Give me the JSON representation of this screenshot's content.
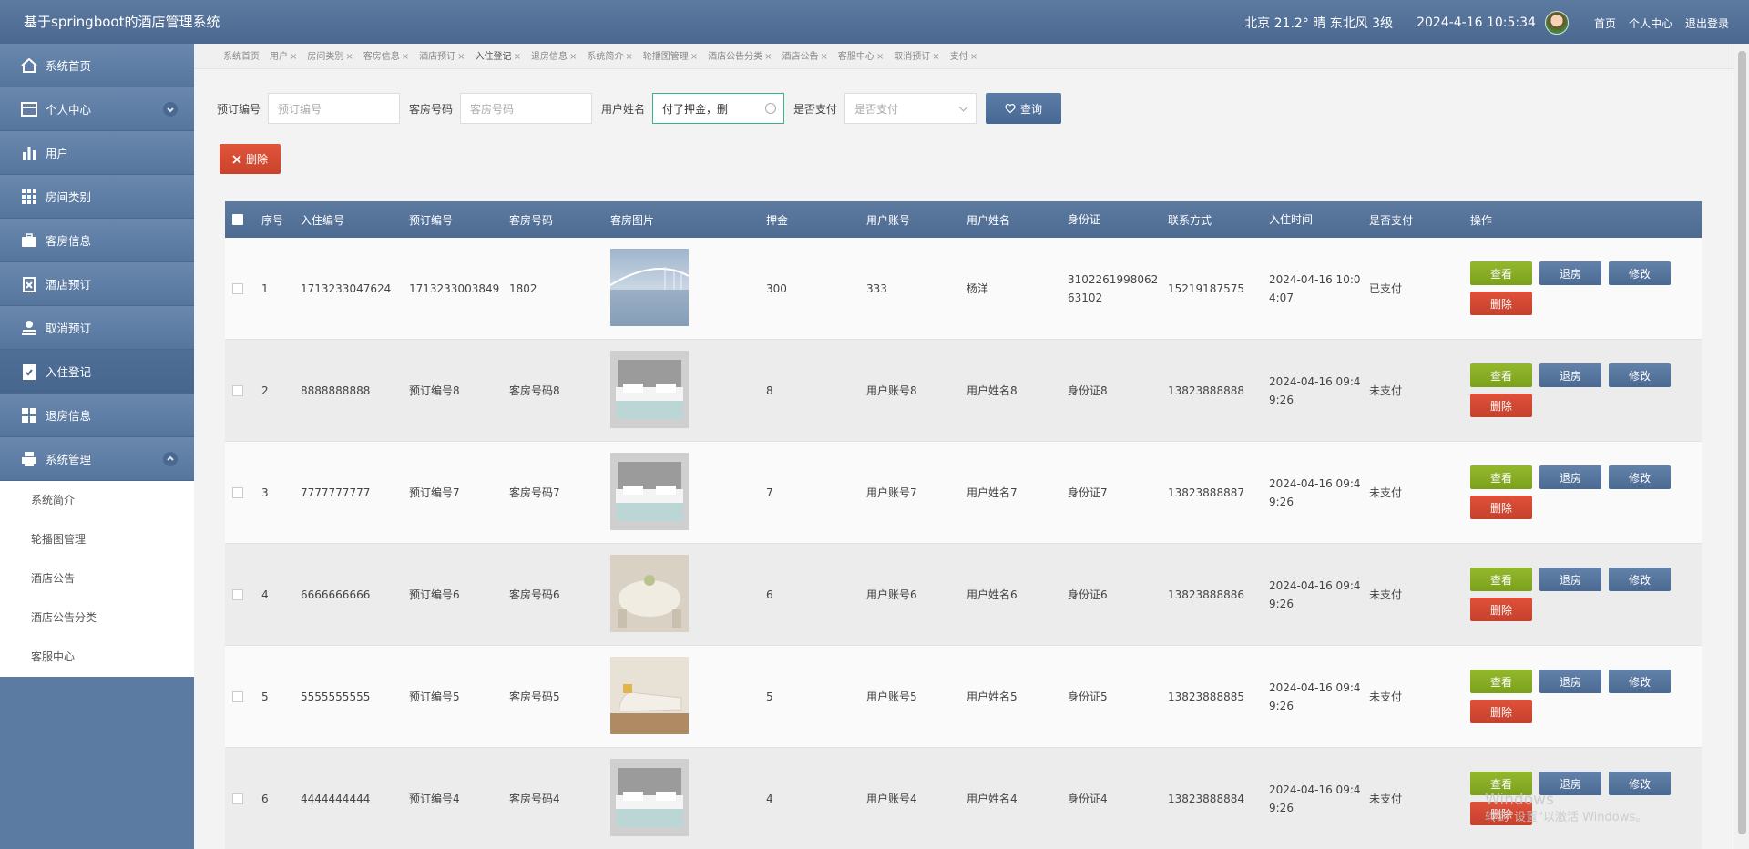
{
  "header": {
    "title": "基于springboot的酒店管理系统",
    "weather": "北京  21.2°  晴  东北风  3级",
    "datetime": "2024-4-16 10:5:34",
    "links": [
      "首页",
      "个人中心",
      "退出登录"
    ]
  },
  "sidebar": {
    "items": [
      {
        "label": "系统首页",
        "icon": "home-icon"
      },
      {
        "label": "个人中心",
        "icon": "card-icon",
        "expandable": true
      },
      {
        "label": "用户",
        "icon": "bar-chart-icon"
      },
      {
        "label": "房间类别",
        "icon": "grid-icon"
      },
      {
        "label": "客房信息",
        "icon": "briefcase-icon"
      },
      {
        "label": "酒店预订",
        "icon": "clipboard-x-icon"
      },
      {
        "label": "取消预订",
        "icon": "stamp-icon"
      },
      {
        "label": "入住登记",
        "icon": "clipboard-check-icon",
        "active": true
      },
      {
        "label": "退房信息",
        "icon": "tiles-icon"
      },
      {
        "label": "系统管理",
        "icon": "printer-icon",
        "expanded": true
      }
    ],
    "subitems": [
      "系统简介",
      "轮播图管理",
      "酒店公告",
      "酒店公告分类",
      "客服中心"
    ]
  },
  "tabs": [
    {
      "label": "系统首页",
      "closable": false
    },
    {
      "label": "用户",
      "closable": true
    },
    {
      "label": "房间类别",
      "closable": true
    },
    {
      "label": "客房信息",
      "closable": true
    },
    {
      "label": "酒店预订",
      "closable": true
    },
    {
      "label": "入住登记",
      "closable": true,
      "active": true
    },
    {
      "label": "退房信息",
      "closable": true
    },
    {
      "label": "系统简介",
      "closable": true
    },
    {
      "label": "轮播图管理",
      "closable": true
    },
    {
      "label": "酒店公告分类",
      "closable": true
    },
    {
      "label": "酒店公告",
      "closable": true
    },
    {
      "label": "客服中心",
      "closable": true
    },
    {
      "label": "取消预订",
      "closable": true
    },
    {
      "label": "支付",
      "closable": true
    }
  ],
  "search": {
    "booking_no_label": "预订编号",
    "booking_no_placeholder": "预订编号",
    "room_no_label": "客房号码",
    "room_no_placeholder": "客房号码",
    "username_label": "用户姓名",
    "username_value": "付了押金，删",
    "paid_label": "是否支付",
    "paid_placeholder": "是否支付",
    "query_label": "查询"
  },
  "delete_label": "删除",
  "table": {
    "headers": [
      "序号",
      "入住编号",
      "预订编号",
      "客房号码",
      "客房图片",
      "押金",
      "用户账号",
      "用户姓名",
      "身份证",
      "联系方式",
      "入住时间",
      "是否支付",
      "操作"
    ],
    "rows": [
      {
        "no": "1",
        "checkin_no": "1713233047624",
        "booking_no": "1713233003849",
        "room_no": "1802",
        "deposit": "300",
        "account": "333",
        "name": "杨洋",
        "id_card": "310226199806263102",
        "phone": "15219187575",
        "time": "2024-04-16 10:04:07",
        "paid": "已支付",
        "image": "bridge-lake-photo"
      },
      {
        "no": "2",
        "checkin_no": "8888888888",
        "booking_no": "预订编号8",
        "room_no": "客房号码8",
        "deposit": "8",
        "account": "用户账号8",
        "name": "用户姓名8",
        "id_card": "身份证8",
        "phone": "13823888888",
        "time": "2024-04-16 09:49:26",
        "paid": "未支付",
        "image": "bedroom-photo"
      },
      {
        "no": "3",
        "checkin_no": "7777777777",
        "booking_no": "预订编号7",
        "room_no": "客房号码7",
        "deposit": "7",
        "account": "用户账号7",
        "name": "用户姓名7",
        "id_card": "身份证7",
        "phone": "13823888887",
        "time": "2024-04-16 09:49:26",
        "paid": "未支付",
        "image": "bedroom-photo"
      },
      {
        "no": "4",
        "checkin_no": "6666666666",
        "booking_no": "预订编号6",
        "room_no": "客房号码6",
        "deposit": "6",
        "account": "用户账号6",
        "name": "用户姓名6",
        "id_card": "身份证6",
        "phone": "13823888886",
        "time": "2024-04-16 09:49:26",
        "paid": "未支付",
        "image": "dining-table-photo"
      },
      {
        "no": "5",
        "checkin_no": "5555555555",
        "booking_no": "预订编号5",
        "room_no": "客房号码5",
        "deposit": "5",
        "account": "用户账号5",
        "name": "用户姓名5",
        "id_card": "身份证5",
        "phone": "13823888885",
        "time": "2024-04-16 09:49:26",
        "paid": "未支付",
        "image": "lounge-chair-photo"
      },
      {
        "no": "6",
        "checkin_no": "4444444444",
        "booking_no": "预订编号4",
        "room_no": "客房号码4",
        "deposit": "4",
        "account": "用户账号4",
        "name": "用户姓名4",
        "id_card": "身份证4",
        "phone": "13823888884",
        "time": "2024-04-16 09:49:26",
        "paid": "未支付",
        "image": "bedroom-photo"
      }
    ],
    "ops": {
      "view": "查看",
      "checkout": "退房",
      "edit": "修改",
      "remove": "删除"
    }
  },
  "watermark": {
    "line1": "Windows",
    "line2": "转到\"设置\"以激活 Windows。"
  },
  "colors": {
    "accent": "#4a6890",
    "danger": "#d44a33",
    "success": "#85aa22"
  }
}
